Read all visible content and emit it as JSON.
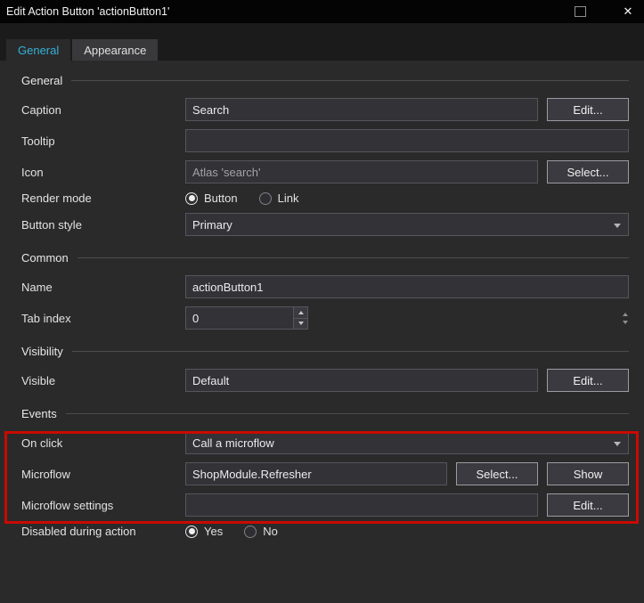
{
  "window": {
    "title": "Edit Action Button 'actionButton1'",
    "close_glyph": "✕"
  },
  "tabs": {
    "general": "General",
    "appearance": "Appearance"
  },
  "general_section": {
    "title": "General",
    "caption": {
      "label": "Caption",
      "value": "Search",
      "button": "Edit..."
    },
    "tooltip": {
      "label": "Tooltip",
      "value": ""
    },
    "icon": {
      "label": "Icon",
      "value": "Atlas 'search'",
      "button": "Select..."
    },
    "render_mode": {
      "label": "Render mode",
      "options": [
        "Button",
        "Link"
      ],
      "selected": "Button"
    },
    "button_style": {
      "label": "Button style",
      "value": "Primary"
    }
  },
  "common_section": {
    "title": "Common",
    "name": {
      "label": "Name",
      "value": "actionButton1"
    },
    "tab_index": {
      "label": "Tab index",
      "value": "0"
    }
  },
  "visibility_section": {
    "title": "Visibility",
    "visible": {
      "label": "Visible",
      "value": "Default",
      "button": "Edit..."
    }
  },
  "events_section": {
    "title": "Events",
    "on_click": {
      "label": "On click",
      "value": "Call a microflow"
    },
    "microflow": {
      "label": "Microflow",
      "value": "ShopModule.Refresher",
      "select_button": "Select...",
      "show_button": "Show"
    }
  },
  "footer_rows": {
    "microflow_settings": {
      "label": "Microflow settings",
      "value": "",
      "button": "Edit..."
    },
    "disabled_during_action": {
      "label": "Disabled during action",
      "options": [
        "Yes",
        "No"
      ],
      "selected": "Yes"
    }
  },
  "annotation": {
    "color": "#c90a02"
  }
}
